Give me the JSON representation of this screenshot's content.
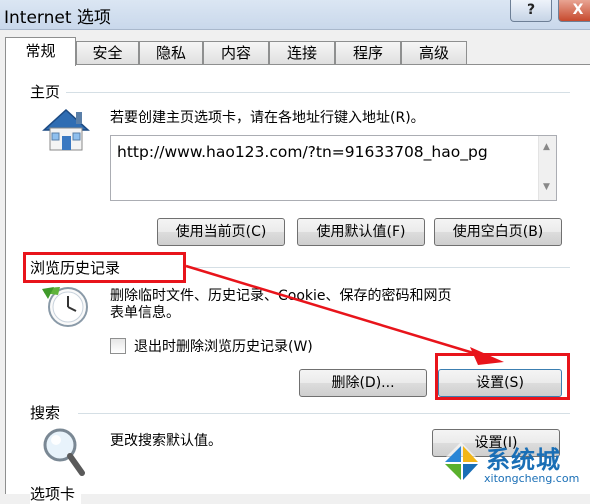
{
  "window": {
    "title": "Internet 选项",
    "help_label": "?",
    "close_label": "X"
  },
  "tabs": [
    {
      "label": "常规"
    },
    {
      "label": "安全"
    },
    {
      "label": "隐私"
    },
    {
      "label": "内容"
    },
    {
      "label": "连接"
    },
    {
      "label": "程序"
    },
    {
      "label": "高级"
    }
  ],
  "homepage": {
    "group_label": "主页",
    "description": "若要创建主页选项卡，请在各地址行键入地址(R)。",
    "url": "http://www.hao123.com/?tn=91633708_hao_pg",
    "buttons": {
      "use_current": "使用当前页(C)",
      "use_default": "使用默认值(F)",
      "use_blank": "使用空白页(B)"
    }
  },
  "history": {
    "group_label": "浏览历史记录",
    "description_line1": "删除临时文件、历史记录、Cookie、保存的密码和网页",
    "description_line2": "表单信息。",
    "checkbox_label": "退出时删除浏览历史记录(W)",
    "delete_button": "删除(D)...",
    "settings_button": "设置(S)"
  },
  "search": {
    "group_label": "搜索",
    "description": "更改搜索默认值。",
    "settings_button": "设置(I)"
  },
  "tabs_group": {
    "group_label": "选项卡"
  },
  "watermark": {
    "title": "系统城",
    "subtitle": "xitongcheng.com"
  },
  "colors": {
    "annotation_red": "#e8141b",
    "watermark_blue": "#1a6fb6"
  }
}
